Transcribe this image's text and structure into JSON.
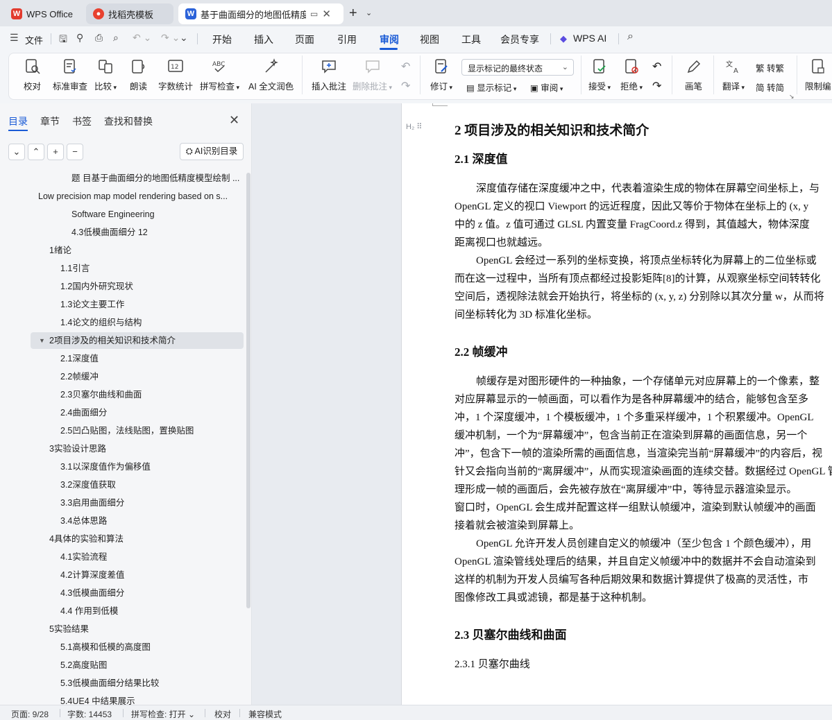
{
  "tabs": [
    {
      "label": "WPS Office",
      "icon": "wps-logo-icon"
    },
    {
      "label": "找稻壳模板",
      "icon": "docer-logo-icon"
    },
    {
      "label": "基于曲面细分的地图低精度模",
      "icon": "word-doc-icon"
    }
  ],
  "menu": {
    "file": "文件",
    "items": [
      "开始",
      "插入",
      "页面",
      "引用",
      "审阅",
      "视图",
      "工具",
      "会员专享"
    ],
    "active": "审阅",
    "wps_ai": "WPS AI"
  },
  "ribbon": {
    "proofread": "校对",
    "standard_review": "标准审查",
    "compare": "比较",
    "read_aloud": "朗读",
    "word_count": "字数统计",
    "spell_check": "拼写检查",
    "ai_polish": "AI 全文润色",
    "insert_comment": "插入批注",
    "delete_comment": "删除批注",
    "track_changes": "修订",
    "markup_select": "显示标记的最终状态",
    "show_markup": "显示标记",
    "review": "审阅",
    "accept": "接受",
    "reject": "拒绝",
    "pen": "画笔",
    "translate": "翻译",
    "to_traditional": "转繁",
    "to_simplified": "转简",
    "restrict_edit": "限制编"
  },
  "sidebar": {
    "tabs": [
      "目录",
      "章节",
      "书签",
      "查找和替换"
    ],
    "active_tab": "目录",
    "ai_button": "AI识别目录",
    "toc": [
      {
        "label": "题 目基于曲面细分的地图低精度模型绘制 ...",
        "level": 3,
        "expanded": null
      },
      {
        "label": "Low precision map model rendering based on s...",
        "level": 0,
        "expanded": true
      },
      {
        "label": "Software Engineering",
        "level": 3,
        "expanded": null
      },
      {
        "label": "4.3低模曲面细分 12",
        "level": 3,
        "expanded": null
      },
      {
        "label": "1绪论",
        "level": 1,
        "expanded": true
      },
      {
        "label": "1.1引言",
        "level": 2,
        "expanded": null
      },
      {
        "label": "1.2国内外研究现状",
        "level": 2,
        "expanded": null
      },
      {
        "label": "1.3论文主要工作",
        "level": 2,
        "expanded": null
      },
      {
        "label": "1.4论文的组织与结构",
        "level": 2,
        "expanded": null
      },
      {
        "label": "2项目涉及的相关知识和技术简介",
        "level": 1,
        "expanded": true,
        "selected": true
      },
      {
        "label": "2.1深度值",
        "level": 2,
        "expanded": null
      },
      {
        "label": "2.2帧缓冲",
        "level": 2,
        "expanded": null
      },
      {
        "label": "2.3贝塞尔曲线和曲面",
        "level": 2,
        "expanded": null
      },
      {
        "label": "2.4曲面细分",
        "level": 2,
        "expanded": null
      },
      {
        "label": "2.5凹凸贴图，法线贴图，置换贴图",
        "level": 2,
        "expanded": null
      },
      {
        "label": "3实验设计思路",
        "level": 1,
        "expanded": true
      },
      {
        "label": "3.1以深度值作为偏移值",
        "level": 2,
        "expanded": null
      },
      {
        "label": "3.2深度值获取",
        "level": 2,
        "expanded": null
      },
      {
        "label": "3.3启用曲面细分",
        "level": 2,
        "expanded": null
      },
      {
        "label": "3.4总体思路",
        "level": 2,
        "expanded": null
      },
      {
        "label": "4具体的实验和算法",
        "level": 1,
        "expanded": true
      },
      {
        "label": "4.1实验流程",
        "level": 2,
        "expanded": null
      },
      {
        "label": "4.2计算深度差值",
        "level": 2,
        "expanded": null
      },
      {
        "label": "4.3低模曲面细分",
        "level": 2,
        "expanded": null
      },
      {
        "label": "4.4 作用到低模",
        "level": 2,
        "expanded": null
      },
      {
        "label": "5实验结果",
        "level": 1,
        "expanded": true
      },
      {
        "label": "5.1高模和低模的高度图",
        "level": 2,
        "expanded": null
      },
      {
        "label": "5.2高度贴图",
        "level": 2,
        "expanded": null
      },
      {
        "label": "5.3低模曲面细分结果比较",
        "level": 2,
        "expanded": null
      },
      {
        "label": "5.4UE4 中结果展示",
        "level": 2,
        "expanded": null
      }
    ]
  },
  "document": {
    "heading_marker": "H₂ ⠿",
    "h1": "2   项目涉及的相关知识和技术简介",
    "sections": [
      {
        "title": "2.1    深度值",
        "style": "h2",
        "lines": [
          {
            "text": "深度值存储在深度缓冲之中，代表着渲染生成的物体在屏幕空间坐标上，与",
            "indent": true
          },
          {
            "text": "OpenGL 定义的视口 Viewport 的远近程度，因此又等价于物体在坐标上的 (x, y",
            "indent": false
          },
          {
            "text": "中的 z 值。z 值可通过 GLSL 内置变量 FragCoord.z 得到，其值越大，物体深度",
            "indent": false
          },
          {
            "text": "距离视口也就越远。",
            "indent": false
          },
          {
            "text": "OpenGL 会经过一系列的坐标变换，将顶点坐标转化为屏幕上的二位坐标或",
            "indent": true
          },
          {
            "text": "而在这一过程中，当所有顶点都经过投影矩阵[8]的计算，从观察坐标空间转转化",
            "indent": false
          },
          {
            "text": "空间后，透视除法就会开始执行，将坐标的 (x, y, z) 分别除以其次分量 w，从而将",
            "indent": false
          },
          {
            "text": "间坐标转化为 3D 标准化坐标。",
            "indent": false
          }
        ]
      },
      {
        "title": "2.2    帧缓冲",
        "style": "h2",
        "lines": [
          {
            "text": "帧缓存是对图形硬件的一种抽象，一个存储单元对应屏幕上的一个像素，整",
            "indent": true
          },
          {
            "text": "对应屏幕显示的一帧画面，可以看作为是各种屏幕缓冲的结合，能够包含至多",
            "indent": false
          },
          {
            "text": "冲，1 个深度缓冲，1 个模板缓冲，1 个多重采样缓冲，1 个积累缓冲。OpenGL",
            "indent": false
          },
          {
            "text": "缓冲机制，一个为“屏幕缓冲”，包含当前正在渲染到屏幕的画面信息，另一个",
            "indent": false
          },
          {
            "text": "冲”，包含下一帧的渲染所需的画面信息，当渲染完当前“屏幕缓冲”的内容后，视",
            "indent": false
          },
          {
            "text": "针又会指向当前的“离屏缓冲”，从而实现渲染画面的连续交替。数据经过 OpenGL 管",
            "indent": false
          },
          {
            "text": "理形成一帧的画面后，会先被存放在“离屏缓冲”中，等待显示器渲染显示。",
            "indent": false
          },
          {
            "text": "窗口时，OpenGL 会生成并配置这样一组默认帧缓冲，渲染到默认帧缓冲的画面",
            "indent": false
          },
          {
            "text": "接着就会被渲染到屏幕上。",
            "indent": false
          },
          {
            "text": "OpenGL 允许开发人员创建自定义的帧缓冲（至少包含 1 个颜色缓冲），用",
            "indent": true
          },
          {
            "text": "OpenGL 渲染管线处理后的结果，并且自定义帧缓冲中的数据并不会自动渲染到",
            "indent": false
          },
          {
            "text": "这样的机制为开发人员编写各种后期效果和数据计算提供了极高的灵活性，市",
            "indent": false
          },
          {
            "text": "图像修改工具或滤镜，都是基于这种机制。",
            "indent": false
          }
        ]
      },
      {
        "title": "2.3    贝塞尔曲线和曲面",
        "style": "h2",
        "lines": []
      },
      {
        "title": "2.3.1    贝塞尔曲线",
        "style": "h3",
        "lines": []
      }
    ]
  },
  "status": {
    "page": "页面: 9/28",
    "words": "字数: 14453",
    "spell": "拼写检查: 打开",
    "proof": "校对",
    "compat": "兼容模式"
  },
  "colors": {
    "accent": "#1a5bd6",
    "wps_red": "#e23b2e",
    "docer_red": "#e8412f",
    "word_blue": "#2b62d9"
  }
}
